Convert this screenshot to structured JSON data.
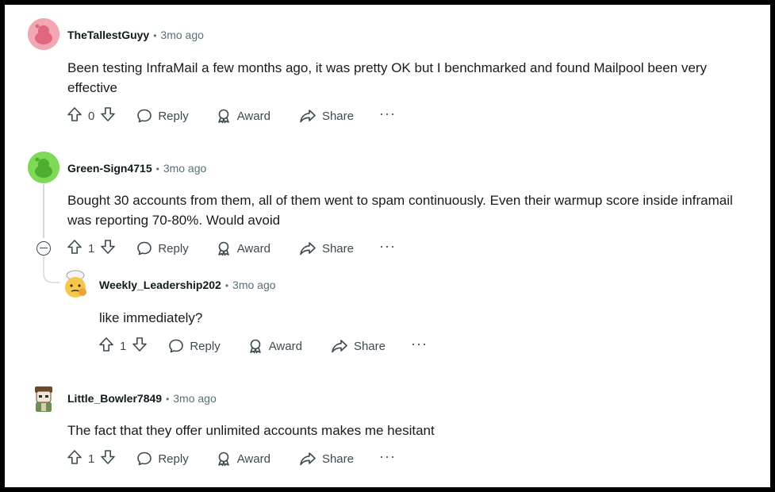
{
  "comments": [
    {
      "author": "TheTallestGuyy",
      "time": "3mo ago",
      "body": "Been testing InfraMail a few months ago, it was pretty OK but I benchmarked and found Mailpool been very effective",
      "votes": "0",
      "avatar_color": "#f08a9b"
    },
    {
      "author": "Green-Sign4715",
      "time": "3mo ago",
      "body": "Bought 30 accounts from them, all of them went to spam continuously. Even their warmup score inside inframail was reporting 70-80%. Would avoid",
      "votes": "1",
      "avatar_color": "#6fd14a"
    },
    {
      "author": "Weekly_Leadership202",
      "time": "3mo ago",
      "body": "like immediately?",
      "votes": "1"
    },
    {
      "author": "Little_Bowler7849",
      "time": "3mo ago",
      "body": "The fact that they offer unlimited accounts makes me hesitant",
      "votes": "1"
    }
  ],
  "actions": {
    "reply": "Reply",
    "award": "Award",
    "share": "Share",
    "more": "···",
    "separator": "•"
  },
  "icons": [
    "upvote-icon",
    "downvote-icon",
    "reply-icon",
    "award-icon",
    "share-icon",
    "more-icon",
    "collapse-icon"
  ]
}
